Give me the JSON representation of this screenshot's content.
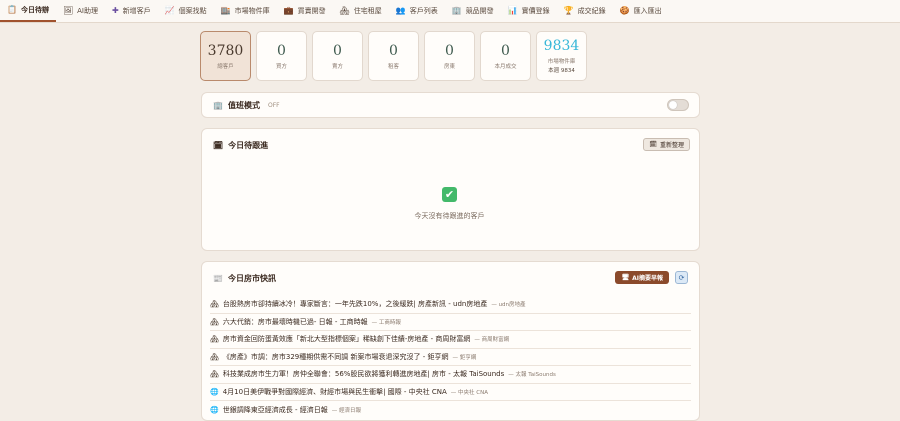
{
  "nav": [
    {
      "icon": "📋",
      "label": "今日待辦",
      "active": true
    },
    {
      "icon": "🖼",
      "label": "AI助理"
    },
    {
      "icon": "✚",
      "label": "新增客戶"
    },
    {
      "icon": "📈",
      "label": "個案找點"
    },
    {
      "icon": "🏬",
      "label": "市場物件庫"
    },
    {
      "icon": "💼",
      "label": "買賣開發"
    },
    {
      "icon": "🏘",
      "label": "住宅租屋"
    },
    {
      "icon": "👥",
      "label": "客戶列表"
    },
    {
      "icon": "🏢",
      "label": "競品開發"
    },
    {
      "icon": "📊",
      "label": "實價登錄"
    },
    {
      "icon": "🏆",
      "label": "成交紀錄"
    },
    {
      "icon": "🍪",
      "label": "匯入匯出"
    }
  ],
  "stats": [
    {
      "value": "3780",
      "label": "總客戶"
    },
    {
      "value": "0",
      "label": "買方"
    },
    {
      "value": "0",
      "label": "賣方"
    },
    {
      "value": "0",
      "label": "租客"
    },
    {
      "value": "0",
      "label": "房東"
    },
    {
      "value": "0",
      "label": "本月成交"
    },
    {
      "value": "9834",
      "label": "市場物件庫",
      "sub": "本週 9834"
    }
  ],
  "duty": {
    "icon": "🏢",
    "title": "值班模式",
    "state": "OFF"
  },
  "followup": {
    "icon": "🗓",
    "title": "今日待跟進",
    "refresh_label": "重新整理",
    "refresh_icon": "🗓",
    "check_icon": "✔",
    "empty_text": "今天沒有待跟進的客戶"
  },
  "news": {
    "icon": "📰",
    "title": "今日房市快訊",
    "ai_label": "AI摘要早報",
    "ai_icon": "🖥",
    "refresh_icon": "⟳",
    "items": [
      {
        "icon": "🏘",
        "title": "台股熱房市卻持續冰冷！專家斷言：一年先跌10%，之後緩跌| 房產新訊 - udn房地產",
        "source": "— udn房地產"
      },
      {
        "icon": "🏘",
        "title": "六大代銷：房市最壞時機已過- 日報 - 工商時報",
        "source": "— 工商時報"
      },
      {
        "icon": "🏘",
        "title": "房市資金回防蛋黃效應「新北大型指標個案」稀缺創下佳績-房地產 - 商周財富網",
        "source": "— 商周財富網"
      },
      {
        "icon": "🏘",
        "title": "《房產》市調：房市329種期供需不同調 新案市場衰退深究沒了 - 鉅亨網",
        "source": "— 鉅亨網"
      },
      {
        "icon": "🏘",
        "title": "科技業成房市生力軍！房仲全聯會：56%股民欲將獲利轉進房地產| 房市 - 太報 TaiSounds",
        "source": "— 太報 TaiSounds"
      },
      {
        "icon": "🌐",
        "title": "4月10日美伊戰爭對國際經濟、財經市場與民生衝擊| 國際 - 中央社 CNA",
        "source": "— 中央社 CNA"
      },
      {
        "icon": "🌐",
        "title": "世銀調降東亞經濟成長 - 經濟日報",
        "source": "— 經濟日報"
      }
    ]
  },
  "colors": {
    "accent": "#a0522d",
    "brand_dark": "#8b4a2b",
    "highlight": "#37b7d8",
    "success": "#43b96a",
    "background": "#f3ede6"
  }
}
